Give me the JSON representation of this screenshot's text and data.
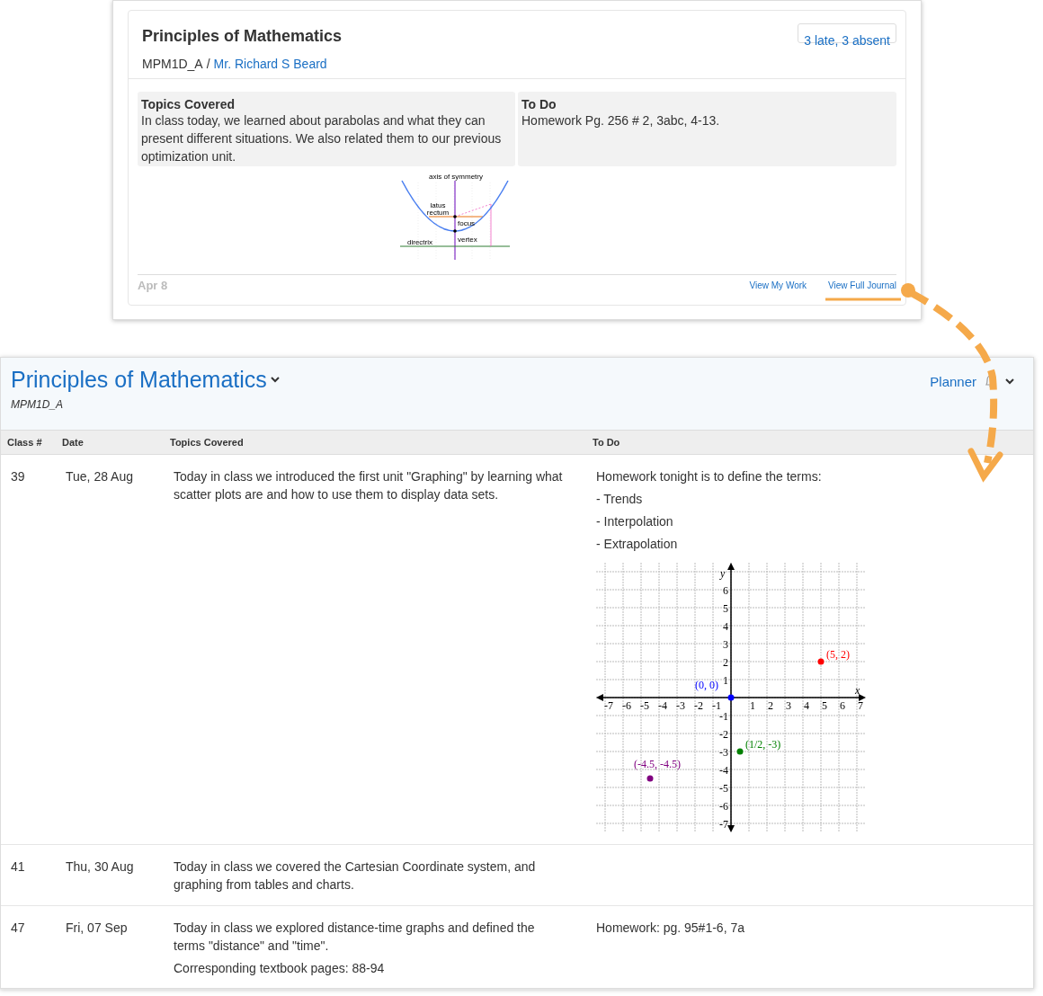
{
  "journal_card": {
    "title": "Principles of Mathematics",
    "course_code": "MPM1D_A",
    "separator": "/",
    "teacher": "Mr. Richard S Beard",
    "attendance": "3 late, 3 absent",
    "topics_heading": "Topics Covered",
    "topics_text": "In class today, we learned about parabolas and what they can present different situations. We also related them to our previous optimization unit.",
    "todo_heading": "To Do",
    "todo_text": "Homework Pg. 256 # 2, 3abc, 4-13.",
    "diagram": {
      "labels": [
        "axis of symmetry",
        "latus",
        "rectum",
        "focus",
        "vertex",
        "directrix"
      ]
    },
    "date": "Apr 8",
    "links": [
      "View My Work",
      "View Full Journal"
    ]
  },
  "journal": {
    "title": "Principles of Mathematics",
    "subtitle": "MPM1D_A",
    "planner": "Planner",
    "columns": [
      "Class #",
      "Date",
      "Topics Covered",
      "To Do"
    ],
    "rows": [
      {
        "class_no": "39",
        "date": "Tue, 28 Aug",
        "topics": [
          "Today in class we introduced the first unit \"Graphing\" by learning what scatter plots are and how to use them to display data sets."
        ],
        "todo": [
          "Homework tonight is to define the terms:",
          "- Trends",
          "- Interpolation",
          "- Extrapolation"
        ],
        "chart_data": {
          "type": "scatter",
          "grid": true,
          "xlabel": "x",
          "ylabel": "y",
          "xlim": [
            -7,
            7
          ],
          "ylim": [
            -7,
            7
          ],
          "xticks": [
            -7,
            -6,
            -5,
            -4,
            -3,
            -2,
            -1,
            1,
            2,
            3,
            4,
            5,
            6,
            7
          ],
          "yticks": [
            -7,
            -6,
            -5,
            -4,
            -3,
            -2,
            -1,
            1,
            2,
            3,
            4,
            5,
            6
          ],
          "series": [
            {
              "name": "(0, 0)",
              "color": "#0000ff",
              "x": [
                0
              ],
              "values": [
                0
              ]
            },
            {
              "name": "(5, 2)",
              "color": "#ff0000",
              "x": [
                5
              ],
              "values": [
                2
              ]
            },
            {
              "name": "(1/2, -3)",
              "color": "#008000",
              "x": [
                0.5
              ],
              "values": [
                -3
              ]
            },
            {
              "name": "(-4.5, -4.5)",
              "color": "#800080",
              "x": [
                -4.5
              ],
              "values": [
                -4.5
              ]
            }
          ]
        }
      },
      {
        "class_no": "41",
        "date": "Thu, 30 Aug",
        "topics": [
          "Today in class we covered the Cartesian Coordinate system, and graphing from tables and charts."
        ],
        "todo": []
      },
      {
        "class_no": "47",
        "date": "Fri, 07 Sep",
        "topics": [
          "Today in class we explored distance-time graphs and defined the terms \"distance\" and \"time\".",
          "Corresponding textbook pages: 88-94"
        ],
        "todo": [
          "Homework: pg. 95#1-6, 7a"
        ]
      }
    ]
  }
}
